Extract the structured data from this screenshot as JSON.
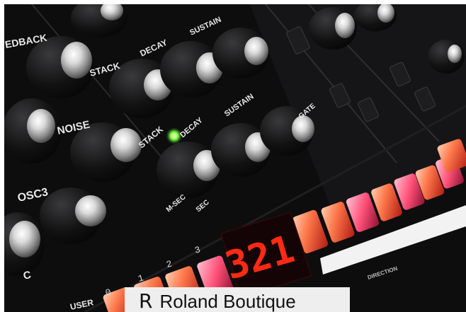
{
  "photo": {
    "subject": "Roland Boutique synthesizer panel",
    "accent_red": "#ff3a1f",
    "led_green": "#7dff4a",
    "panel_color": "#0c0c0d"
  },
  "panel_labels": {
    "feedback": "EDBACK",
    "stack_top": "STACK",
    "stack_lower": "STACK",
    "noise": "NOISE",
    "osc3": "OSC3",
    "c_label": "C",
    "decay": "DECAY",
    "decay_lower": "DECAY",
    "sustain": "SUSTAIN",
    "sustain_lower": "SUSTAIN",
    "sec": "SEC",
    "msec": "M-SEC",
    "user": "USER",
    "gate": "GATE",
    "direction": "DIRECTION"
  },
  "display": {
    "value": "321"
  },
  "step_buttons": [
    "0",
    "1",
    "2",
    "3"
  ],
  "caption": {
    "logo_glyph": "R",
    "text": "Roland Boutique"
  }
}
